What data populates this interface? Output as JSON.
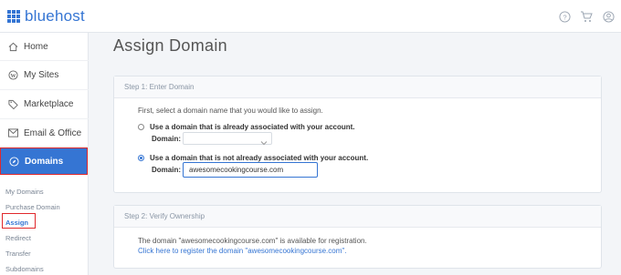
{
  "app": {
    "brand": "bluehost"
  },
  "sidebar": {
    "items": [
      {
        "label": "Home",
        "icon": "home-icon"
      },
      {
        "label": "My Sites",
        "icon": "wordpress-icon"
      },
      {
        "label": "Marketplace",
        "icon": "tag-icon"
      },
      {
        "label": "Email & Office",
        "icon": "envelope-icon"
      },
      {
        "label": "Domains",
        "icon": "compass-icon"
      }
    ],
    "sub_items": [
      "My Domains",
      "Purchase Domain",
      "Assign",
      "Redirect",
      "Transfer",
      "Subdomains"
    ]
  },
  "main": {
    "title": "Assign Domain",
    "step1": {
      "header": "Step 1: Enter Domain",
      "intro": "First, select a domain name that you would like to assign.",
      "option_existing": "Use a domain that is already associated with your account.",
      "option_new": "Use a domain that is not already associated with your account.",
      "domain_label": "Domain:",
      "domain_value": "awesomecookingcourse.com"
    },
    "step2": {
      "header": "Step 2: Verify Ownership",
      "message": "The domain \"awesomecookingcourse.com\" is available for registration.",
      "link": "Click here to register the domain \"awesomecookingcourse.com\"."
    }
  },
  "colors": {
    "brand_blue": "#3575d3",
    "highlight_red": "#e0282c"
  }
}
